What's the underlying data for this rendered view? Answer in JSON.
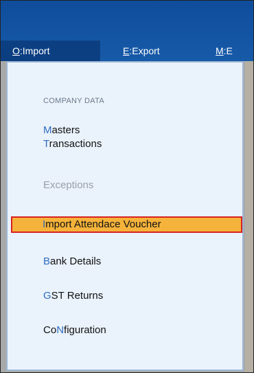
{
  "menu_bar": {
    "items": [
      {
        "hotkey": "O",
        "label": ":Import"
      },
      {
        "hotkey": "E",
        "label": ":Export"
      },
      {
        "hotkey": "M",
        "label": ":E"
      }
    ]
  },
  "dropdown": {
    "section_title": "COMPANY DATA",
    "items": [
      {
        "hotkey": "M",
        "rest": "asters"
      },
      {
        "hotkey": "T",
        "rest": "ransactions"
      },
      {
        "label": "Exceptions"
      },
      {
        "hotkey": "I",
        "rest": "mport Attendace Voucher"
      },
      {
        "hotkey": "B",
        "rest": "ank Details"
      },
      {
        "hotkey": "G",
        "rest": "ST Returns"
      },
      {
        "pre": "Co",
        "hotkey": "N",
        "rest": "figuration"
      }
    ]
  },
  "colors": {
    "title_bar": "#175aa8",
    "active_menu": "#0c3f82",
    "dropdown_bg": "#eaf2fb",
    "highlight": "#f5b33b",
    "highlight_border": "#d82020",
    "hotkey": "#2d6cc0"
  }
}
